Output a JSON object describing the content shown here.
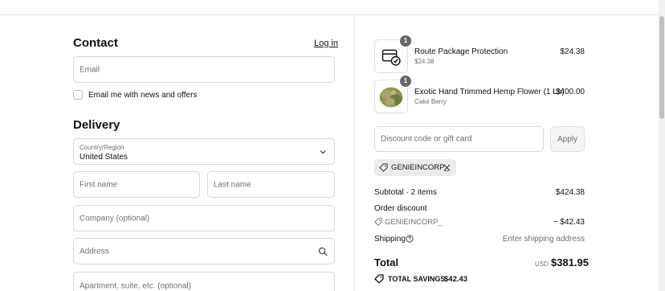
{
  "contact": {
    "title": "Contact",
    "login_link": "Log in",
    "email_placeholder": "Email",
    "newsletter_label": "Email me with news and offers"
  },
  "delivery": {
    "title": "Delivery",
    "country_label": "Country/Region",
    "country_value": "United States",
    "first_name_placeholder": "First name",
    "last_name_placeholder": "Last name",
    "company_placeholder": "Company (optional)",
    "address_placeholder": "Address",
    "apartment_placeholder": "Apartment, suite, etc. (optional)"
  },
  "summary": {
    "items": [
      {
        "name": "Route Package Protection",
        "sub": "$24.38",
        "price": "$24.38",
        "qty": "1",
        "icon": "package-protection-icon"
      },
      {
        "name": "Exotic Hand Trimmed Hemp Flower (1 Lb)",
        "sub": "Cake Berry",
        "price": "$400.00",
        "qty": "1",
        "icon": "hemp-flower-image"
      }
    ],
    "discount_placeholder": "Discount code or gift card",
    "apply_label": "Apply",
    "applied_code": "GENIEINCORP_",
    "subtotal_label": "Subtotal · 2 items",
    "subtotal_value": "$424.38",
    "order_discount_label": "Order discount",
    "discount_code": "GENIEINCORP_",
    "discount_value": "− $42.43",
    "shipping_label": "Shipping",
    "shipping_value": "Enter shipping address",
    "total_label": "Total",
    "currency": "USD",
    "total_value": "$381.95",
    "savings_label": "TOTAL SAVINGS",
    "savings_value": "$42.43"
  }
}
